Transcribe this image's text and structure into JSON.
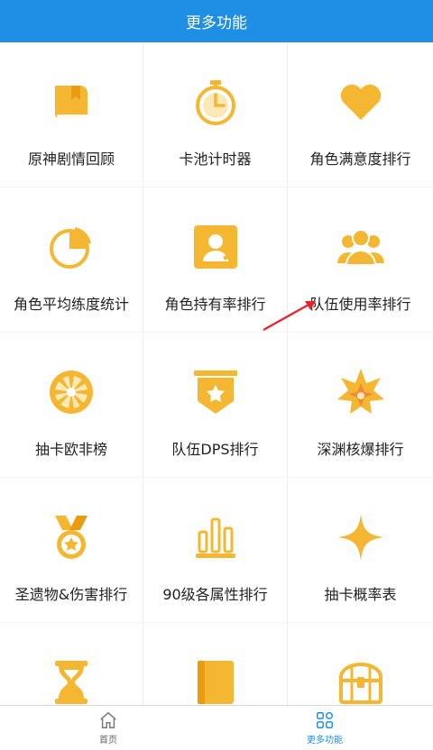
{
  "header": {
    "title": "更多功能"
  },
  "colors": {
    "accent": "#1f8fe6",
    "icon": "#f5b731"
  },
  "features": [
    {
      "label": "原神剧情回顾",
      "icon": "book-icon"
    },
    {
      "label": "卡池计时器",
      "icon": "stopwatch-icon"
    },
    {
      "label": "角色满意度排行",
      "icon": "heart-icon"
    },
    {
      "label": "角色平均练度统计",
      "icon": "pie-chart-icon"
    },
    {
      "label": "角色持有率排行",
      "icon": "user-card-icon"
    },
    {
      "label": "队伍使用率排行",
      "icon": "group-icon"
    },
    {
      "label": "抽卡欧非榜",
      "icon": "wheel-icon"
    },
    {
      "label": "队伍DPS排行",
      "icon": "star-banner-icon"
    },
    {
      "label": "深渊核爆排行",
      "icon": "explosion-icon"
    },
    {
      "label": "圣遗物&伤害排行",
      "icon": "medal-icon"
    },
    {
      "label": "90级各属性排行",
      "icon": "bar-chart-icon"
    },
    {
      "label": "抽卡概率表",
      "icon": "sparkle-icon"
    },
    {
      "label": "",
      "icon": "hourglass-icon"
    },
    {
      "label": "",
      "icon": "notebook-icon"
    },
    {
      "label": "",
      "icon": "treasure-chest-icon"
    }
  ],
  "tabbar": {
    "home_label": "首页",
    "more_label": "更多功能"
  }
}
